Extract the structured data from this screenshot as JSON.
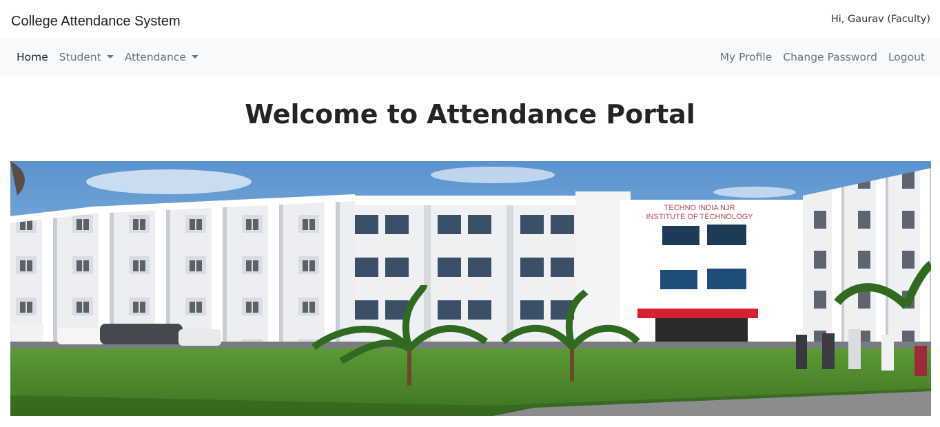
{
  "header": {
    "brand": "College Attendance System",
    "greeting": "Hi, Gaurav (Faculty)"
  },
  "nav": {
    "left": [
      {
        "label": "Home",
        "active": true,
        "dropdown": false
      },
      {
        "label": "Student",
        "active": false,
        "dropdown": true
      },
      {
        "label": "Attendance",
        "active": false,
        "dropdown": true
      }
    ],
    "right": [
      {
        "label": "My Profile"
      },
      {
        "label": "Change Password"
      },
      {
        "label": "Logout"
      }
    ]
  },
  "main": {
    "title": "Welcome to Attendance Portal",
    "banner": {
      "sign_line1": "TECHNO INDIA NJR",
      "sign_line2": "INSTITUTE OF TECHNOLOGY"
    }
  },
  "colors": {
    "navbar_bg": "#f8f9fa",
    "nav_link": "#6c757d",
    "nav_active": "#212529",
    "sign_text": "#b4485a",
    "canopy": "#d4202f"
  }
}
